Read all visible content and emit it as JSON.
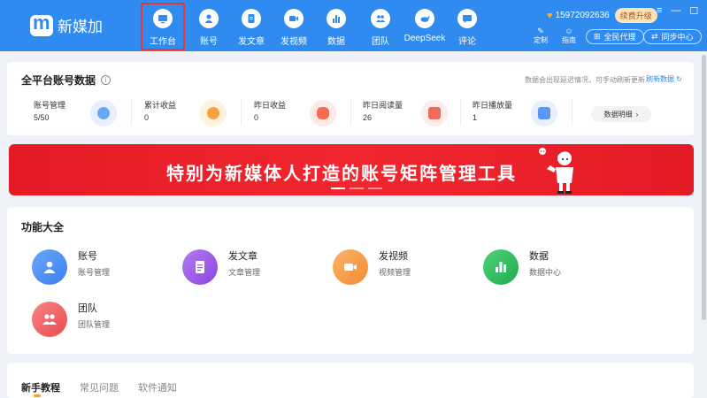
{
  "app": {
    "name": "新媒加"
  },
  "nav": [
    {
      "label": "工作台",
      "icon": "monitor-icon",
      "active": true
    },
    {
      "label": "账号",
      "icon": "user-icon"
    },
    {
      "label": "发文章",
      "icon": "document-icon"
    },
    {
      "label": "发视频",
      "icon": "video-icon"
    },
    {
      "label": "数据",
      "icon": "bar-chart-icon"
    },
    {
      "label": "团队",
      "icon": "team-icon"
    },
    {
      "label": "DeepSeek",
      "icon": "whale-icon"
    },
    {
      "label": "评论",
      "icon": "comment-icon"
    }
  ],
  "header": {
    "phone": "15972092636",
    "upgrade": "续费升级",
    "customize": "定制",
    "guide": "指南",
    "agent": "全民代理",
    "sync": "同步中心"
  },
  "stats": {
    "title": "全平台账号数据",
    "note": "数据会出现延迟情况，可手动刷新更新",
    "refresh": "刷新数据",
    "detail": "数据明细",
    "items": [
      {
        "label": "账号管理",
        "value": "5/50"
      },
      {
        "label": "累计收益",
        "value": "0"
      },
      {
        "label": "昨日收益",
        "value": "0"
      },
      {
        "label": "昨日阅读量",
        "value": "26"
      },
      {
        "label": "昨日播放量",
        "value": "1"
      }
    ]
  },
  "banner": {
    "text": "特别为新媒体人打造的账号矩阵管理工具"
  },
  "features": {
    "title": "功能大全",
    "items": [
      {
        "name": "账号",
        "desc": "账号管理",
        "color": "#4a8df5"
      },
      {
        "name": "发文章",
        "desc": "文章管理",
        "color": "#9b59e6"
      },
      {
        "name": "发视频",
        "desc": "视频管理",
        "color": "#f59a42"
      },
      {
        "name": "数据",
        "desc": "数据中心",
        "color": "#31c060"
      },
      {
        "name": "团队",
        "desc": "团队管理",
        "color": "#f06466"
      }
    ]
  },
  "tutorials": {
    "tabs": [
      "新手教程",
      "常见问题",
      "软件通知"
    ]
  },
  "colors": {
    "brand": "#2f8bf0",
    "banner": "#e31b26",
    "tab_indicator": "#ff9f1a"
  }
}
